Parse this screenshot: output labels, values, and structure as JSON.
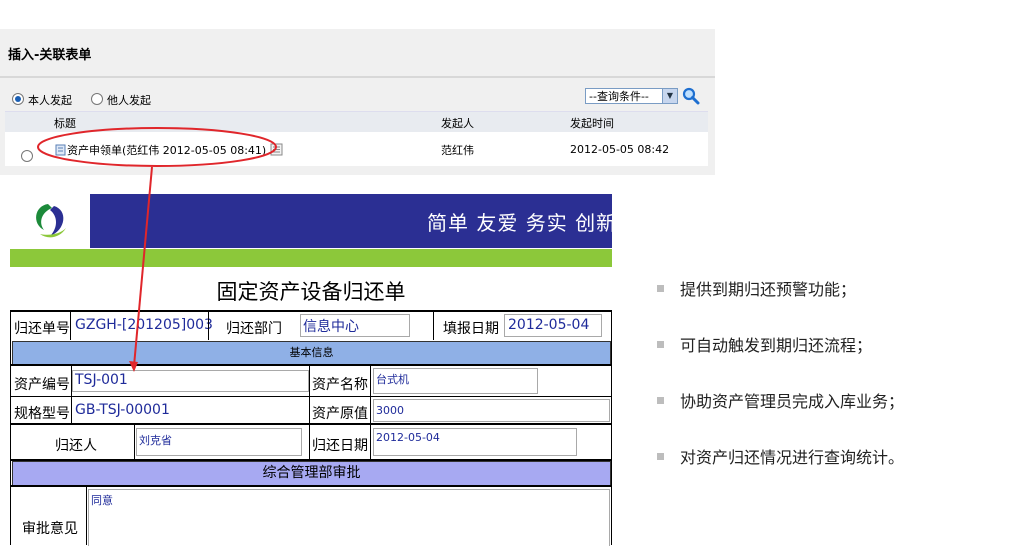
{
  "panel": {
    "title": "插入-关联表单",
    "radio_self": "本人发起",
    "radio_others": "他人发起",
    "query_select": "--查询条件--",
    "columns": [
      "标题",
      "发起人",
      "发起时间"
    ],
    "row": {
      "title": "资产申领单(范红伟 2012-05-05 08:41)",
      "initiator": "范红伟",
      "time": "2012-05-05 08:42"
    }
  },
  "banner": {
    "slogan": "简单 友爱 务实 创新"
  },
  "form": {
    "title": "固定资产设备归还单",
    "return_no_label": "归还单号",
    "return_no": "GZGH-[201205]003",
    "dept_label": "归还部门",
    "dept": "信息中心",
    "fill_date_label": "填报日期",
    "fill_date": "2012-05-04",
    "basic_info": "基本信息",
    "asset_no_label": "资产编号",
    "asset_no": "TSJ-001",
    "asset_name_label": "资产名称",
    "asset_name": "台式机",
    "spec_label": "规格型号",
    "spec": "GB-TSJ-00001",
    "orig_value_label": "资产原值",
    "orig_value": "3000",
    "returner_label": "归还人",
    "returner": "刘克省",
    "return_date_label": "归还日期",
    "return_date": "2012-05-04",
    "approval_section": "综合管理部审批",
    "opinion_label": "审批意见",
    "opinion": "同意"
  },
  "features": [
    "提供到期归还预警功能；",
    "可自动触发到期归还流程；",
    "协助资产管理员完成入库业务；",
    "对资产归还情况进行查询统计。"
  ],
  "colors": {
    "banner": "#2b2f93",
    "green_bar": "#8cc83a",
    "section_blue": "#8fb0e6",
    "section_purple": "#a7a9f2",
    "highlight_red": "#e0262b",
    "value_text": "#1f2b9a"
  }
}
